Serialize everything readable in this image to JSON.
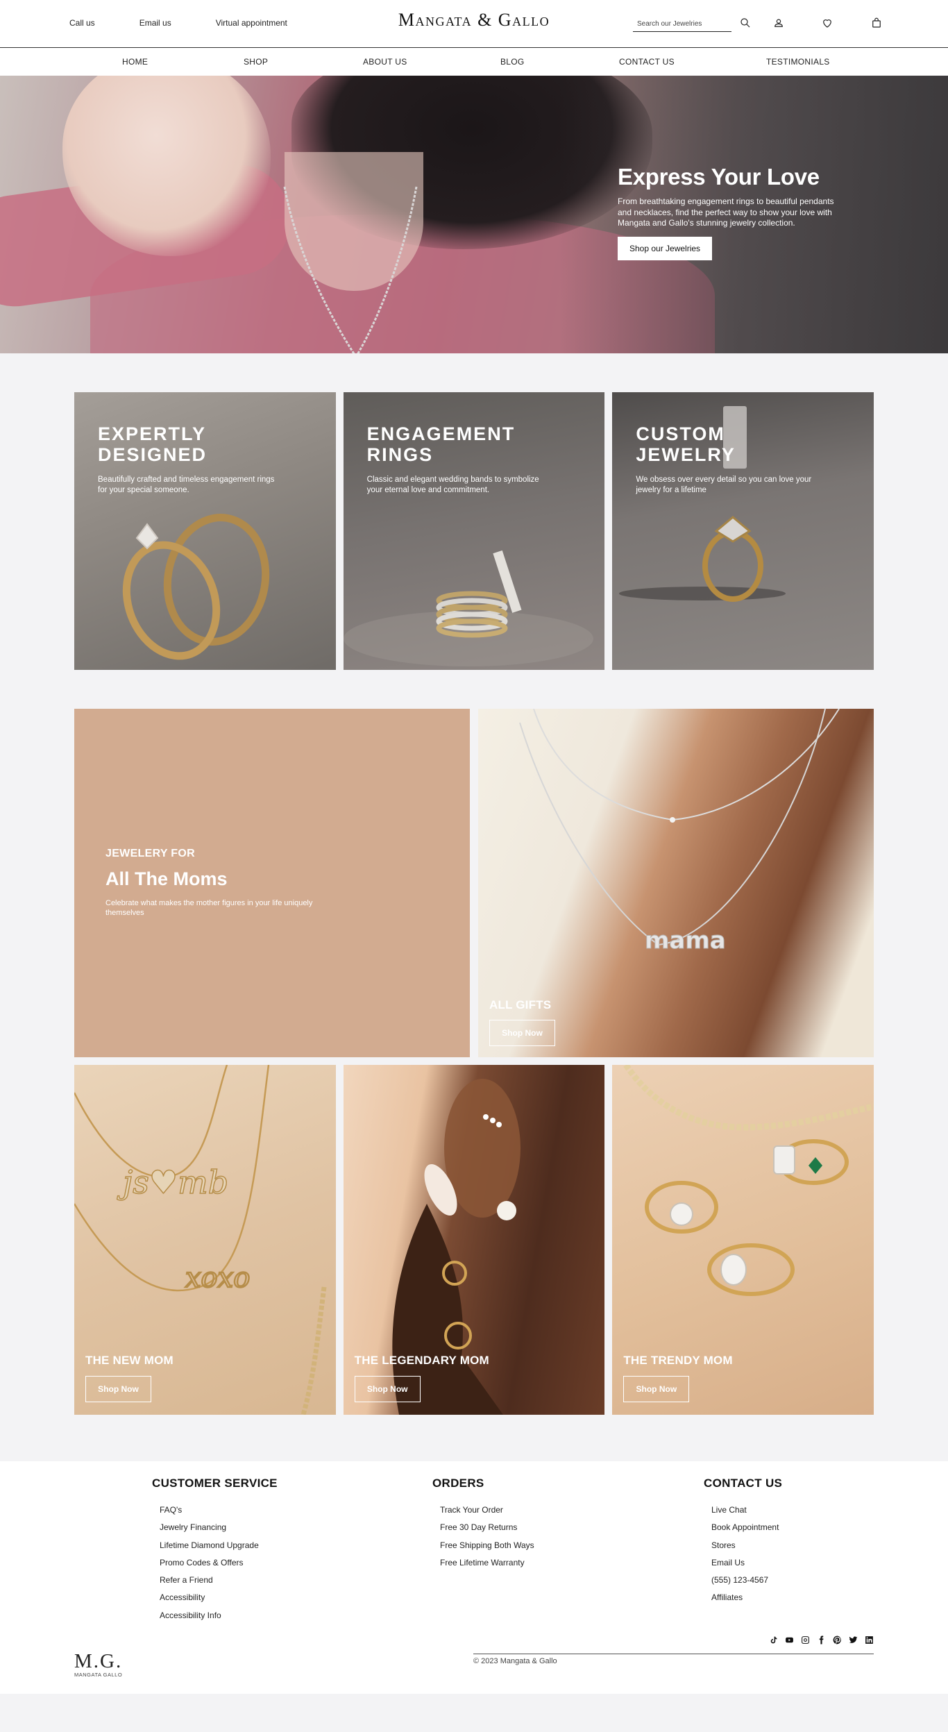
{
  "header": {
    "links": [
      "Call us",
      "Email us",
      "Virtual appointment"
    ],
    "logo": "Mangata & Gallo",
    "search_placeholder": "Search our Jewelries"
  },
  "nav": [
    "HOME",
    "SHOP",
    "ABOUT US",
    "BLOG",
    "CONTACT US",
    "TESTIMONIALS"
  ],
  "hero": {
    "title": "Express Your Love",
    "text": "From breathtaking engagement rings to beautiful pendants and necklaces, find the perfect way to show your love with Mangata and Gallo's stunning jewelry collection.",
    "button": "Shop our Jewelries"
  },
  "categories": [
    {
      "title": "EXPERTLY DESIGNED",
      "text": "Beautifully crafted and timeless engagement rings for your special someone."
    },
    {
      "title": "ENGAGEMENT RINGS",
      "text": "Classic and elegant wedding bands to symbolize your eternal love and commitment."
    },
    {
      "title": "CUSTOM JEWELRY",
      "text": "We obsess over every detail so you can love your jewelry for a lifetime"
    }
  ],
  "moms": {
    "kicker": "JEWELERY FOR",
    "title": "All The Moms",
    "text": "Celebrate what makes the mother figures in your life uniquely themselves",
    "gifts_label": "ALL GIFTS",
    "gifts_button": "Shop Now",
    "necklace_word": "mama"
  },
  "tiles": [
    {
      "label": "THE NEW MOM",
      "button": "Shop Now"
    },
    {
      "label": "THE LEGENDARY MOM",
      "button": "Shop Now"
    },
    {
      "label": "THE TRENDY MOM",
      "button": "Shop Now"
    }
  ],
  "footer": {
    "customer_service": {
      "title": "CUSTOMER SERVICE",
      "items": [
        "FAQ's",
        "Jewelry Financing",
        "Lifetime Diamond Upgrade",
        "Promo Codes & Offers",
        "Refer a Friend",
        "Accessibility",
        "Accessibility Info"
      ]
    },
    "orders": {
      "title": "ORDERS",
      "items": [
        "Track Your Order",
        "Free 30 Day Returns",
        "Free Shipping Both Ways",
        "Free Lifetime Warranty"
      ]
    },
    "contact": {
      "title": "CONTACT US",
      "items": [
        "Live Chat",
        "Book Appointment",
        "Stores",
        "Email Us",
        "(555) 123-4567",
        "Affiliates"
      ]
    },
    "monogram": "M.G.",
    "monogram_sub": "MANGATA GALLO",
    "copyright": "© 2023 Mangata & Gallo",
    "social": [
      "tiktok-icon",
      "youtube-icon",
      "instagram-icon",
      "facebook-icon",
      "pinterest-icon",
      "twitter-icon",
      "linkedin-icon"
    ]
  }
}
